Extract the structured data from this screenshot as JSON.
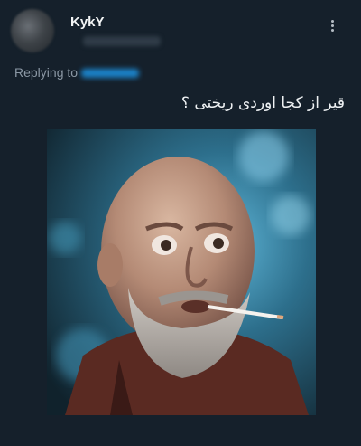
{
  "tweet": {
    "author_name": "KykY",
    "replying_label": "Replying to",
    "text": "قیر از کجا اوردی ریختی ؟",
    "more_icon": "more-vertical-icon"
  },
  "colors": {
    "background": "#15202b",
    "link": "#1d9bf0",
    "muted": "#8b98a5"
  }
}
